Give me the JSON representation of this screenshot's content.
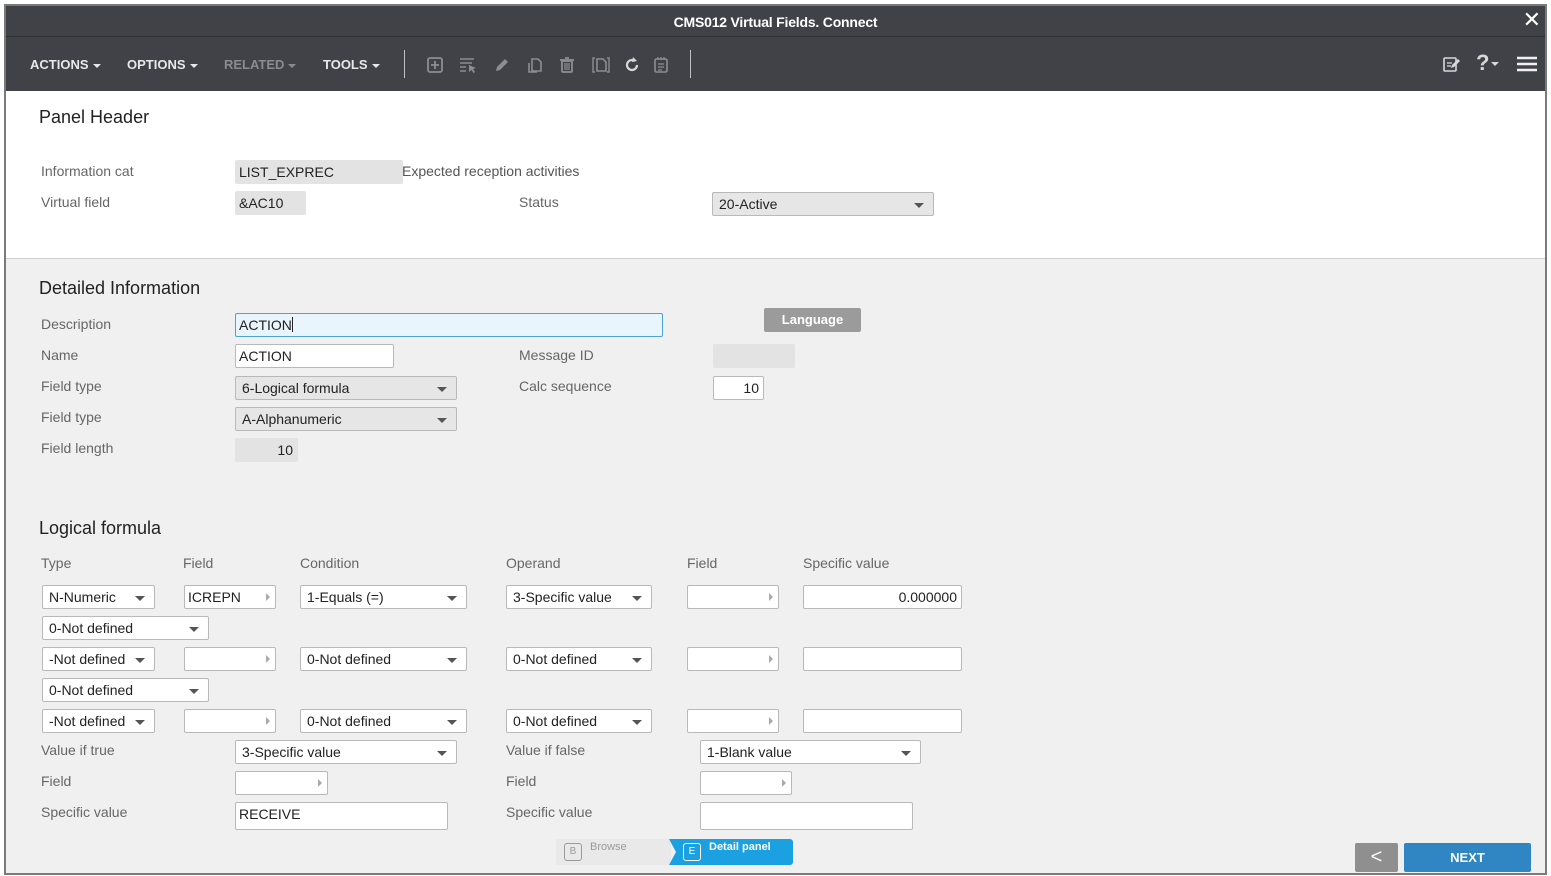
{
  "window": {
    "title": "CMS012 Virtual Fields. Connect",
    "close_icon": "close-icon"
  },
  "toolbar": {
    "menus": [
      {
        "label": "ACTIONS",
        "enabled": true
      },
      {
        "label": "OPTIONS",
        "enabled": true
      },
      {
        "label": "RELATED",
        "enabled": false
      },
      {
        "label": "TOOLS",
        "enabled": true
      }
    ],
    "icons": [
      "add-icon",
      "select-list-icon",
      "edit-icon",
      "copy-icon",
      "delete-icon",
      "duplicate-icon",
      "refresh-icon",
      "notes-icon"
    ],
    "right_icons": [
      "edit-notes-icon",
      "help-icon",
      "hamburger-menu-icon"
    ],
    "help_label": "?"
  },
  "panel_header": {
    "title": "Panel Header",
    "information_cat": {
      "label": "Information cat",
      "value": "LIST_EXPREC",
      "description": "Expected reception activities"
    },
    "virtual_field": {
      "label": "Virtual field",
      "value": "&AC10"
    },
    "status": {
      "label": "Status",
      "value": "20-Active"
    }
  },
  "detailed_information": {
    "title": "Detailed Information",
    "description": {
      "label": "Description",
      "value": "ACTION"
    },
    "language_button": "Language",
    "name": {
      "label": "Name",
      "value": "ACTION"
    },
    "message_id": {
      "label": "Message ID",
      "value": ""
    },
    "field_type_1": {
      "label": "Field type",
      "value": "6-Logical formula"
    },
    "calc_sequence": {
      "label": "Calc sequence",
      "value": "10"
    },
    "field_type_2": {
      "label": "Field type",
      "value": "A-Alphanumeric"
    },
    "field_length": {
      "label": "Field length",
      "value": "10"
    }
  },
  "logical_formula": {
    "title": "Logical formula",
    "columns": [
      "Type",
      "Field",
      "Condition",
      "Operand",
      "Field",
      "Specific value"
    ],
    "rows": [
      {
        "type": "N-Numeric",
        "field": "ICREPN",
        "condition": "1-Equals (=)",
        "operand": "3-Specific value",
        "field2": "",
        "specific_value": "0.000000",
        "connector": "0-Not defined"
      },
      {
        "type": "-Not defined",
        "field": "",
        "condition": "0-Not defined",
        "operand": "0-Not defined",
        "field2": "",
        "specific_value": "",
        "connector": "0-Not defined"
      },
      {
        "type": "-Not defined",
        "field": "",
        "condition": "0-Not defined",
        "operand": "0-Not defined",
        "field2": "",
        "specific_value": ""
      }
    ],
    "value_if_true": {
      "label": "Value if true",
      "value": "3-Specific value"
    },
    "true_field": {
      "label": "Field",
      "value": ""
    },
    "true_specific_value": {
      "label": "Specific value",
      "value": "RECEIVE"
    },
    "value_if_false": {
      "label": "Value if false",
      "value": "1-Blank value"
    },
    "false_field": {
      "label": "Field",
      "value": ""
    },
    "false_specific_value": {
      "label": "Specific value",
      "value": ""
    }
  },
  "footer": {
    "steps": [
      {
        "badge": "B",
        "label": "Browse",
        "active": false
      },
      {
        "badge": "E",
        "label": "Detail panel",
        "active": true
      }
    ],
    "prev_label": "<",
    "next_label": "NEXT"
  },
  "colors": {
    "toolbar_bg": "#414247",
    "active_step": "#1ba1e2",
    "next_button": "#2f86c3",
    "focus_border": "#4aa3df"
  }
}
